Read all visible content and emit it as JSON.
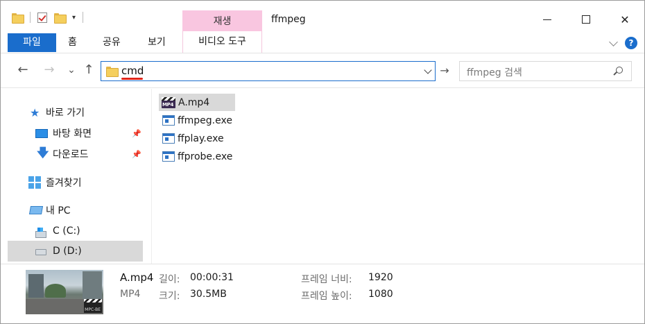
{
  "window": {
    "title": "ffmpeg",
    "context_tab_header": "재생",
    "controls": {
      "minimize": "minimize",
      "maximize": "maximize",
      "close": "✕"
    }
  },
  "ribbon": {
    "file_tab": "파일",
    "tabs": [
      "홈",
      "공유",
      "보기"
    ],
    "context_tab": "비디오 도구",
    "help": "?"
  },
  "nav": {
    "back": "←",
    "forward": "→",
    "recent": "⌄",
    "up": "↑",
    "address": "cmd",
    "go": "→",
    "search_placeholder": "ffmpeg 검색"
  },
  "sidebar": {
    "items": [
      {
        "label": "바로 가기",
        "icon": "star-icon"
      },
      {
        "label": "바탕 화면",
        "icon": "desktop-icon",
        "pinned": true
      },
      {
        "label": "다운로드",
        "icon": "download-icon",
        "pinned": true
      },
      {
        "label": "즐겨찾기",
        "icon": "favorites-icon"
      },
      {
        "label": "내 PC",
        "icon": "computer-icon"
      },
      {
        "label": "C (C:)",
        "icon": "drive-c-icon"
      },
      {
        "label": "D (D:)",
        "icon": "drive-d-icon",
        "selected": true
      }
    ]
  },
  "files": [
    {
      "name": "A.mp4",
      "icon": "video-file-icon",
      "selected": true
    },
    {
      "name": "ffmpeg.exe",
      "icon": "exe-file-icon"
    },
    {
      "name": "ffplay.exe",
      "icon": "exe-file-icon"
    },
    {
      "name": "ffprobe.exe",
      "icon": "exe-file-icon"
    }
  ],
  "details": {
    "name": "A.mp4",
    "type": "MP4",
    "length_label": "길이:",
    "length_value": "00:00:31",
    "size_label": "크기:",
    "size_value": "30.5MB",
    "frame_width_label": "프레임 너비:",
    "frame_width_value": "1920",
    "frame_height_label": "프레임 높이:",
    "frame_height_value": "1080",
    "thumb_badge": "MPC-BE"
  },
  "colors": {
    "accent": "#1a6dcc",
    "context_tab": "#f9c6e0",
    "selection": "#d9d9d9",
    "address_underline": "#e0261b"
  }
}
